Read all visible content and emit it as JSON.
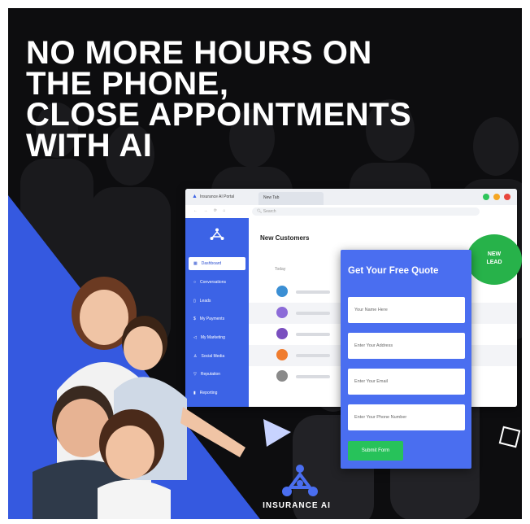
{
  "headline": [
    "NO MORE HOURS ON",
    "THE PHONE,",
    "CLOSE APPOINTMENTS",
    "WITH AI"
  ],
  "browser": {
    "app_name": "Insurance AI Portal",
    "tab_label": "New Tab",
    "search_placeholder": "Search",
    "nav_glyphs": "← → ⟳ ⌂",
    "window_dots": [
      "#2ec55b",
      "#f5a623",
      "#e8453c"
    ]
  },
  "sidebar": {
    "items": [
      {
        "label": "Dashboard",
        "icon": "grid-icon"
      },
      {
        "label": "Conversations",
        "icon": "chat-icon"
      },
      {
        "label": "Leads",
        "icon": "document-icon"
      },
      {
        "label": "My Payments",
        "icon": "dollar-icon"
      },
      {
        "label": "My Marketing",
        "icon": "megaphone-icon"
      },
      {
        "label": "Social Media",
        "icon": "person-icon"
      },
      {
        "label": "Reputation",
        "icon": "trophy-icon"
      },
      {
        "label": "Reporting",
        "icon": "chart-icon"
      }
    ]
  },
  "content": {
    "title": "New Customers",
    "today_label": "Today",
    "avatars": [
      "#3b8fd4",
      "#8c6bd8",
      "#7a4fbf",
      "#f07c2e",
      "#8a8a8a"
    ]
  },
  "badge": {
    "line1": "NEW",
    "line2": "LEAD"
  },
  "quote_form": {
    "title": "Get Your Free Quote",
    "fields": [
      "Your Name Here",
      "Enter Your Address",
      "Enter Your Email",
      "Enter Your Phone Number"
    ],
    "submit_label": "Submit Form"
  },
  "brand": {
    "name": "INSURANCE AI"
  },
  "colors": {
    "accent_blue": "#3c63e6",
    "green": "#27b24a",
    "background": "#0d0d0f"
  }
}
